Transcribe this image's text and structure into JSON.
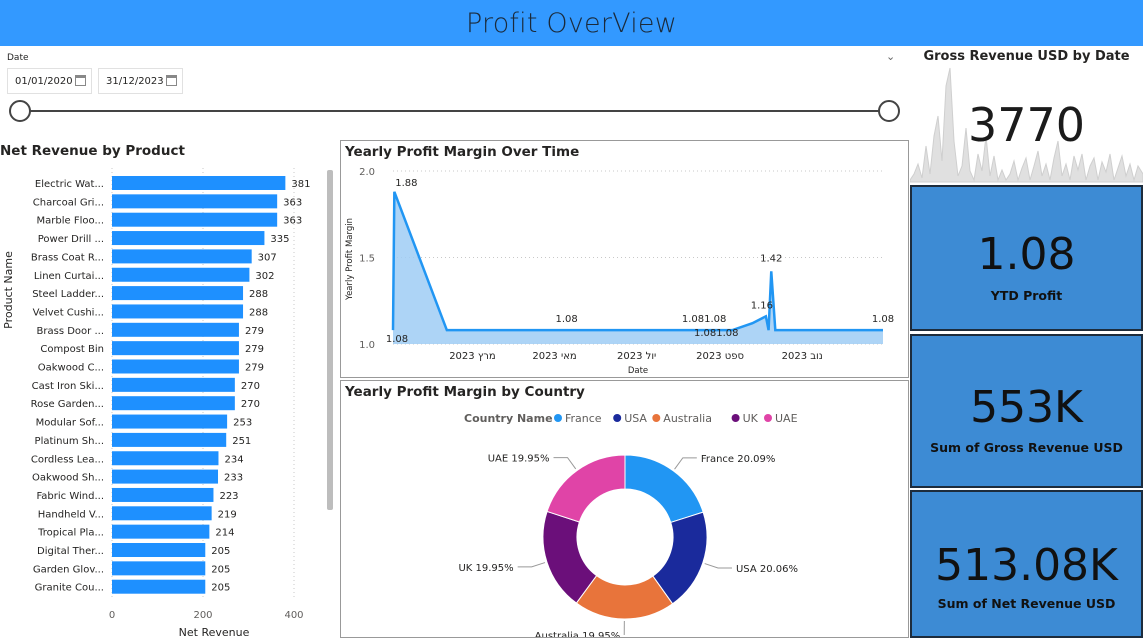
{
  "header": {
    "title": "Profit OverView"
  },
  "slicer": {
    "label": "Date",
    "start_date": "01/01/2020",
    "end_date": "31/12/2023",
    "chevron": "⌄"
  },
  "gross_card": {
    "title": "Gross Revenue USD by Date",
    "value": "3770"
  },
  "kpis": [
    {
      "value": "1.08",
      "label": "YTD Profit"
    },
    {
      "value": "553K",
      "label": "Sum of Gross Revenue USD"
    },
    {
      "value": "513.08K",
      "label": "Sum of Net Revenue USD"
    }
  ],
  "colors": {
    "header": "#3399ff",
    "bar": "#1e90ff",
    "kpi_bg": "#3d8bd4",
    "area": "#9fcdf5",
    "line": "#2196f3"
  },
  "chart_data": [
    {
      "type": "bar",
      "orientation": "horizontal",
      "title": "Net Revenue by Product",
      "xlabel": "Net Revenue",
      "ylabel": "Product Name",
      "xlim": [
        0,
        420
      ],
      "xticks": [
        "0",
        "200",
        "400"
      ],
      "categories": [
        "Electric Wat...",
        "Charcoal Gri...",
        "Marble Floo...",
        "Power Drill ...",
        "Brass Coat R...",
        "Linen Curtai...",
        "Steel Ladder...",
        "Velvet Cushi...",
        "Brass Door ...",
        "Compost Bin",
        "Oakwood C...",
        "Cast Iron Ski...",
        "Rose Garden...",
        "Modular Sof...",
        "Platinum Sh...",
        "Cordless Lea...",
        "Oakwood Sh...",
        "Fabric Wind...",
        "Handheld V...",
        "Tropical Pla...",
        "Digital Ther...",
        "Garden Glov...",
        "Granite Cou..."
      ],
      "values": [
        381,
        363,
        363,
        335,
        307,
        302,
        288,
        288,
        279,
        279,
        279,
        270,
        270,
        253,
        251,
        234,
        233,
        223,
        219,
        214,
        205,
        205,
        205
      ]
    },
    {
      "type": "area",
      "title": "Yearly Profit Margin Over Time",
      "xlabel": "Date",
      "ylabel": "Yearly Profit Margin",
      "ylim": [
        1.0,
        2.0
      ],
      "yticks": [
        "1.0",
        "1.5",
        "2.0"
      ],
      "xticks": [
        "מרץ 2023",
        "מאי 2023",
        "יול 2023",
        "ספט 2023",
        "נוב 2023"
      ],
      "x": [
        "2023-01-01",
        "2023-01-02",
        "2023-02-10",
        "2023-03-15",
        "2023-05-10",
        "2023-07-10",
        "2023-08-20",
        "2023-09-01",
        "2023-09-10",
        "2023-09-25",
        "2023-10-05",
        "2023-10-07",
        "2023-10-09",
        "2023-10-12",
        "2023-10-15",
        "2023-12-31"
      ],
      "values": [
        1.08,
        1.88,
        1.08,
        1.08,
        1.08,
        1.08,
        1.08,
        1.08,
        1.08,
        1.12,
        1.16,
        1.08,
        1.42,
        1.08,
        1.08,
        1.08
      ],
      "data_labels": [
        {
          "text": "1.88",
          "index": 1
        },
        {
          "text": "1.08",
          "index": 0
        },
        {
          "text": "1.08",
          "index": 4
        },
        {
          "text": "1.081.08",
          "index": 7
        },
        {
          "text": "1.081.08",
          "index": 8
        },
        {
          "text": "1.16",
          "index": 10
        },
        {
          "text": "1.42",
          "index": 12
        },
        {
          "text": "1.08",
          "index": 15
        }
      ]
    },
    {
      "type": "pie",
      "donut": true,
      "title": "Yearly Profit Margin by Country",
      "legend_title": "Country Name",
      "legend_position": "top",
      "categories": [
        "France",
        "USA",
        "Australia",
        "UK",
        "UAE"
      ],
      "values": [
        20.09,
        20.06,
        19.95,
        19.95,
        19.95
      ],
      "data_labels": [
        "France 20.09%",
        "USA 20.06%",
        "Australia 19.95%",
        "UK 19.95%",
        "UAE 19.95%"
      ],
      "colors": [
        "#2196f3",
        "#1a2a9c",
        "#e8743b",
        "#6b0f7a",
        "#e044a7"
      ]
    }
  ]
}
